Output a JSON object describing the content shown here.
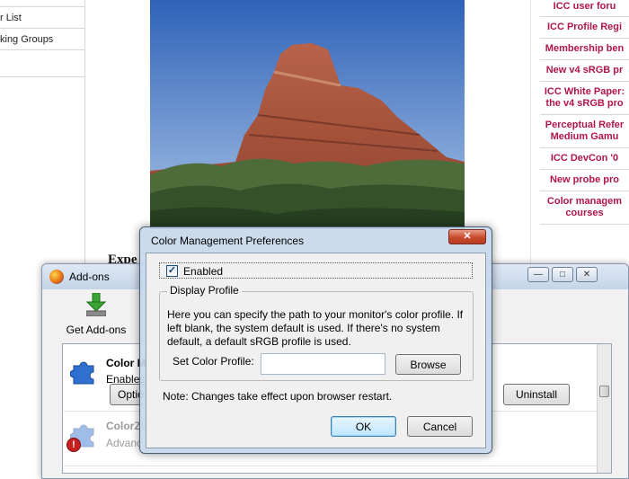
{
  "web_page": {
    "left_nav": [
      {
        "label": ""
      },
      {
        "label": "r List"
      },
      {
        "label": "king Groups"
      },
      {
        "label": ""
      }
    ],
    "heading": "Expe",
    "right_links": [
      {
        "label": "ICC user foru"
      },
      {
        "label": "ICC Profile Regi"
      },
      {
        "label": "Membership ben"
      },
      {
        "label": "New v4 sRGB pr"
      },
      {
        "label": "ICC White Paper:\nthe v4 sRGB pro"
      },
      {
        "label": "Perceptual Refer\nMedium Gamu"
      },
      {
        "label": "ICC DevCon '0"
      },
      {
        "label": "New probe pro"
      },
      {
        "label": "Color managem\ncourses"
      }
    ],
    "link_color": "#b0154c"
  },
  "addons_window": {
    "title": "Add-ons",
    "get_addons_label": "Get Add-ons",
    "items": [
      {
        "name": "Color M",
        "description": "Enables",
        "options_label": "Optio",
        "uninstall_label": "Uninstall",
        "icon": "puzzle-piece-icon"
      },
      {
        "name": "ColorZil",
        "description": "Advanc",
        "icon": "puzzle-piece-icon",
        "badge_icon": "error-badge-icon"
      }
    ],
    "controls": {
      "minimize": "—",
      "maximize": "□",
      "close": "✕"
    }
  },
  "cm_dialog": {
    "title": "Color Management Preferences",
    "close_glyph": "✕",
    "enabled_label": "Enabled",
    "enabled_checked": true,
    "check_glyph": "✓",
    "group_title": "Display Profile",
    "description": "Here you can specify the path to your monitor's color profile. If left blank, the system default is used. If there's no system default, a default sRGB profile is used.",
    "set_profile_label": "Set Color Profile:",
    "profile_value": "",
    "browse_label": "Browse",
    "note": "Note: Changes take effect upon browser restart.",
    "ok_label": "OK",
    "cancel_label": "Cancel"
  }
}
